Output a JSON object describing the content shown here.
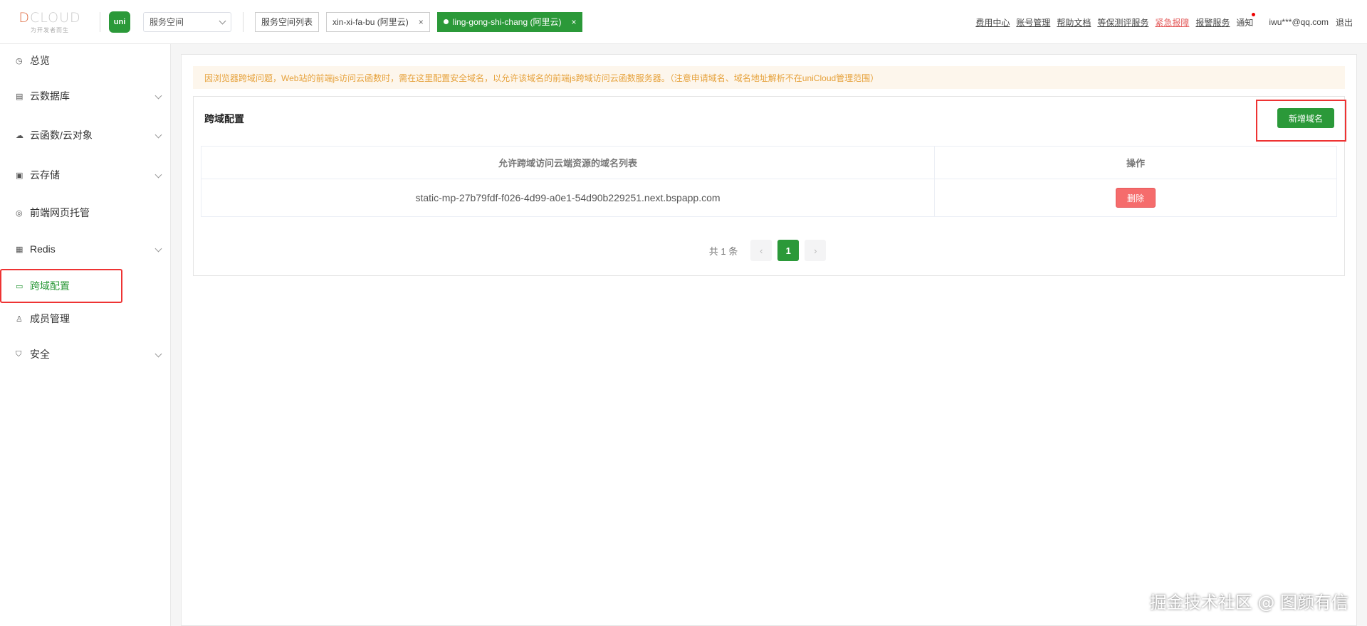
{
  "header": {
    "logo": {
      "brand": "CLOUD",
      "brand_mark": "D",
      "slogan": "为开发者而生"
    },
    "uni_logo": "uni",
    "space_select": "服务空间",
    "space_list_button": "服务空间列表",
    "tabs": [
      {
        "label": "xin-xi-fa-bu (阿里云)",
        "active": false
      },
      {
        "label": "ling-gong-shi-chang (阿里云)",
        "active": true
      }
    ],
    "links": [
      "费用中心",
      "账号管理",
      "帮助文档",
      "等保测评服务",
      "紧急报障",
      "报警服务"
    ],
    "notice": "通知",
    "user": "iwu***@qq.com",
    "logout": "退出"
  },
  "sidebar": {
    "items": [
      {
        "label": "总览",
        "icon": "clock-icon",
        "expandable": false
      },
      {
        "label": "云数据库",
        "icon": "database-icon",
        "expandable": true
      },
      {
        "label": "云函数/云对象",
        "icon": "cloud-icon",
        "expandable": true
      },
      {
        "label": "云存储",
        "icon": "storage-icon",
        "expandable": true
      },
      {
        "label": "前端网页托管",
        "icon": "web-icon",
        "expandable": false
      },
      {
        "label": "Redis",
        "icon": "redis-icon",
        "expandable": true
      },
      {
        "label": "跨域配置",
        "icon": "cross-domain-icon",
        "expandable": false,
        "active": true
      },
      {
        "label": "成员管理",
        "icon": "member-icon",
        "expandable": false
      },
      {
        "label": "安全",
        "icon": "shield-icon",
        "expandable": true
      }
    ]
  },
  "main": {
    "alert": "因浏览器跨域问题，Web站的前端js访问云函数时，需在这里配置安全域名，以允许该域名的前端js跨域访问云函数服务器。（注意申请域名、域名地址解析不在uniCloud管理范围）",
    "title": "跨域配置",
    "add_button": "新增域名",
    "table": {
      "headers": [
        "允许跨域访问云端资源的域名列表",
        "操作"
      ],
      "rows": [
        {
          "domain": "static-mp-27b79fdf-f026-4d99-a0e1-54d90b229251.next.bspapp.com",
          "action": "删除"
        }
      ]
    },
    "pagination": {
      "total": "共 1 条",
      "current": "1",
      "prev": "‹",
      "next": "›"
    }
  },
  "watermark": "掘金技术社区 @ 图颜有信",
  "colors": {
    "accent": "#2b9939",
    "danger": "#f56c6c",
    "warning": "#e6a23c",
    "highlight": "#e33333"
  }
}
